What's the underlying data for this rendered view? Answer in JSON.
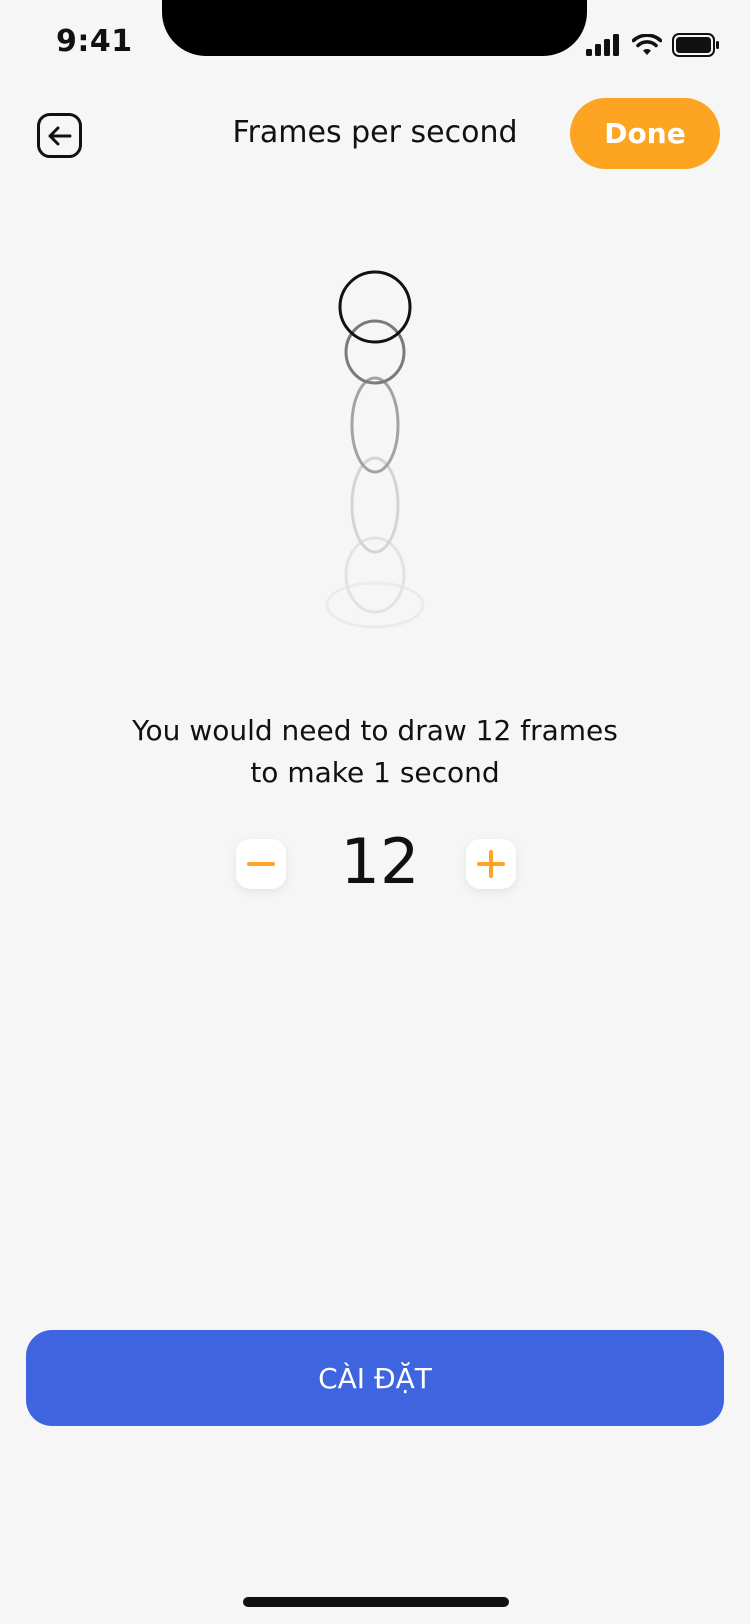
{
  "status_bar": {
    "time": "9:41"
  },
  "header": {
    "title": "Frames per second",
    "done_label": "Done"
  },
  "description": {
    "line1": "You would need to draw 12 frames",
    "line2": "to make 1 second"
  },
  "stepper": {
    "value": "12"
  },
  "primary_button": {
    "label": "CÀI ĐẶT"
  },
  "colors": {
    "accent": "#fda523",
    "primary": "#3f64df",
    "background": "#f6f6f6"
  },
  "icons": {
    "back": "arrow-left-icon",
    "minus": "minus-icon",
    "plus": "plus-icon"
  }
}
